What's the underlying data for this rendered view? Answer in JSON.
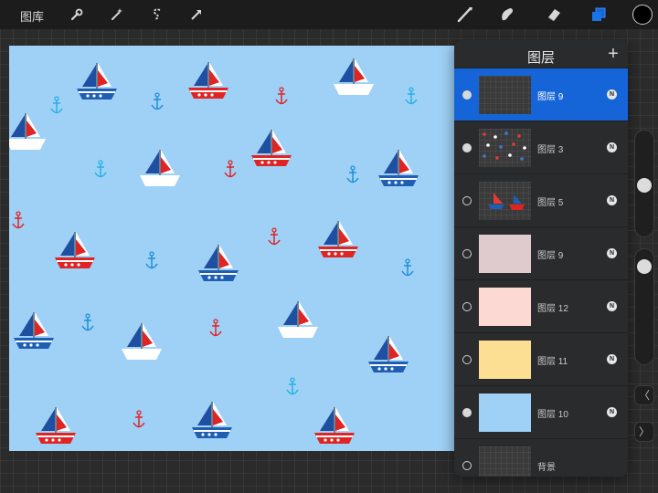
{
  "toolbar": {
    "gallery_label": "图库",
    "left_icons": [
      "wrench-icon",
      "magic-wand-icon",
      "selection-icon",
      "transform-arrow-icon"
    ],
    "right_icons": [
      "brush-icon",
      "smudge-icon",
      "eraser-icon",
      "layers-icon"
    ],
    "current_color": "#000000"
  },
  "layers_panel": {
    "title": "图层",
    "add_label": "+",
    "layers": [
      {
        "name": "图层 9",
        "visible": true,
        "selected": true,
        "blend": "N",
        "thumb": "checker-empty"
      },
      {
        "name": "图层 3",
        "visible": true,
        "selected": false,
        "blend": "N",
        "thumb": "checker-pattern"
      },
      {
        "name": "图层 5",
        "visible": false,
        "selected": false,
        "blend": "N",
        "thumb": "checker-boats"
      },
      {
        "name": "图层 9",
        "visible": false,
        "selected": false,
        "blend": "N",
        "thumb": "#dfcbcd"
      },
      {
        "name": "图层 12",
        "visible": false,
        "selected": false,
        "blend": "N",
        "thumb": "#fcdad3"
      },
      {
        "name": "图层 11",
        "visible": false,
        "selected": false,
        "blend": "N",
        "thumb": "#fddf93"
      },
      {
        "name": "图层 10",
        "visible": true,
        "selected": false,
        "blend": "N",
        "thumb": "#9fd1f6"
      },
      {
        "name": "背景",
        "visible": false,
        "selected": false,
        "blend": "",
        "thumb": "checker-empty"
      }
    ]
  },
  "canvas": {
    "background_color": "#9fd1f6",
    "pattern": "sailboats and anchors"
  },
  "sidebar": {
    "undo_label": "〈",
    "redo_label": "〉"
  }
}
